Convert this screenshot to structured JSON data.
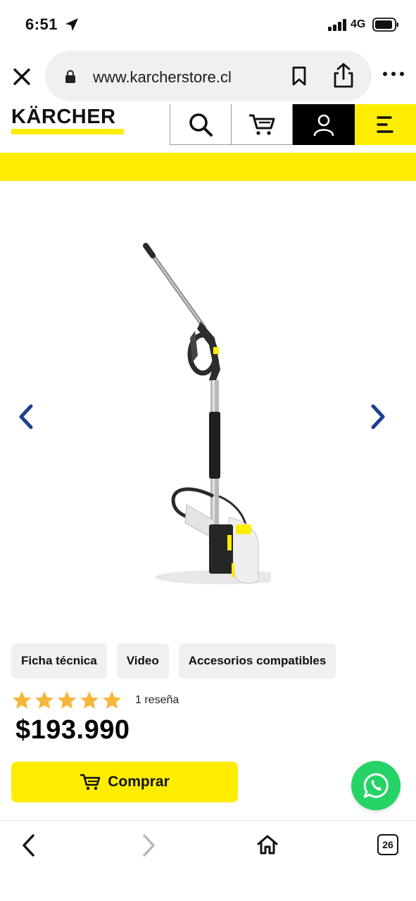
{
  "status_bar": {
    "time": "6:51",
    "network": "4G"
  },
  "browser": {
    "url": "www.karcherstore.cl",
    "icons": [
      "close-icon",
      "lock-icon",
      "bookmark-icon",
      "share-icon",
      "more-icon"
    ]
  },
  "site_header": {
    "logo": "KÄRCHER",
    "icons": [
      "search-icon",
      "cart-icon",
      "user-icon",
      "menu-icon"
    ],
    "brand_yellow": "#ffed00"
  },
  "gallery": {
    "icons": [
      "chevron-left-icon",
      "chevron-right-icon"
    ],
    "arrow_color": "#1f3f8f"
  },
  "tabs": [
    "Ficha técnica",
    "Video",
    "Accesorios compatibles"
  ],
  "rating": {
    "stars": 5,
    "reviews_label": "1 reseña",
    "star_color": "#f5b73b"
  },
  "price": "$193.990",
  "buy_button": {
    "label": "Comprar",
    "icon": "cart-icon"
  },
  "whatsapp": {
    "icon": "whatsapp-icon",
    "color": "#25d366"
  },
  "bottom_bar": {
    "tab_count": "26",
    "icons": [
      "back-icon",
      "forward-icon",
      "home-icon",
      "tabs-icon"
    ]
  }
}
